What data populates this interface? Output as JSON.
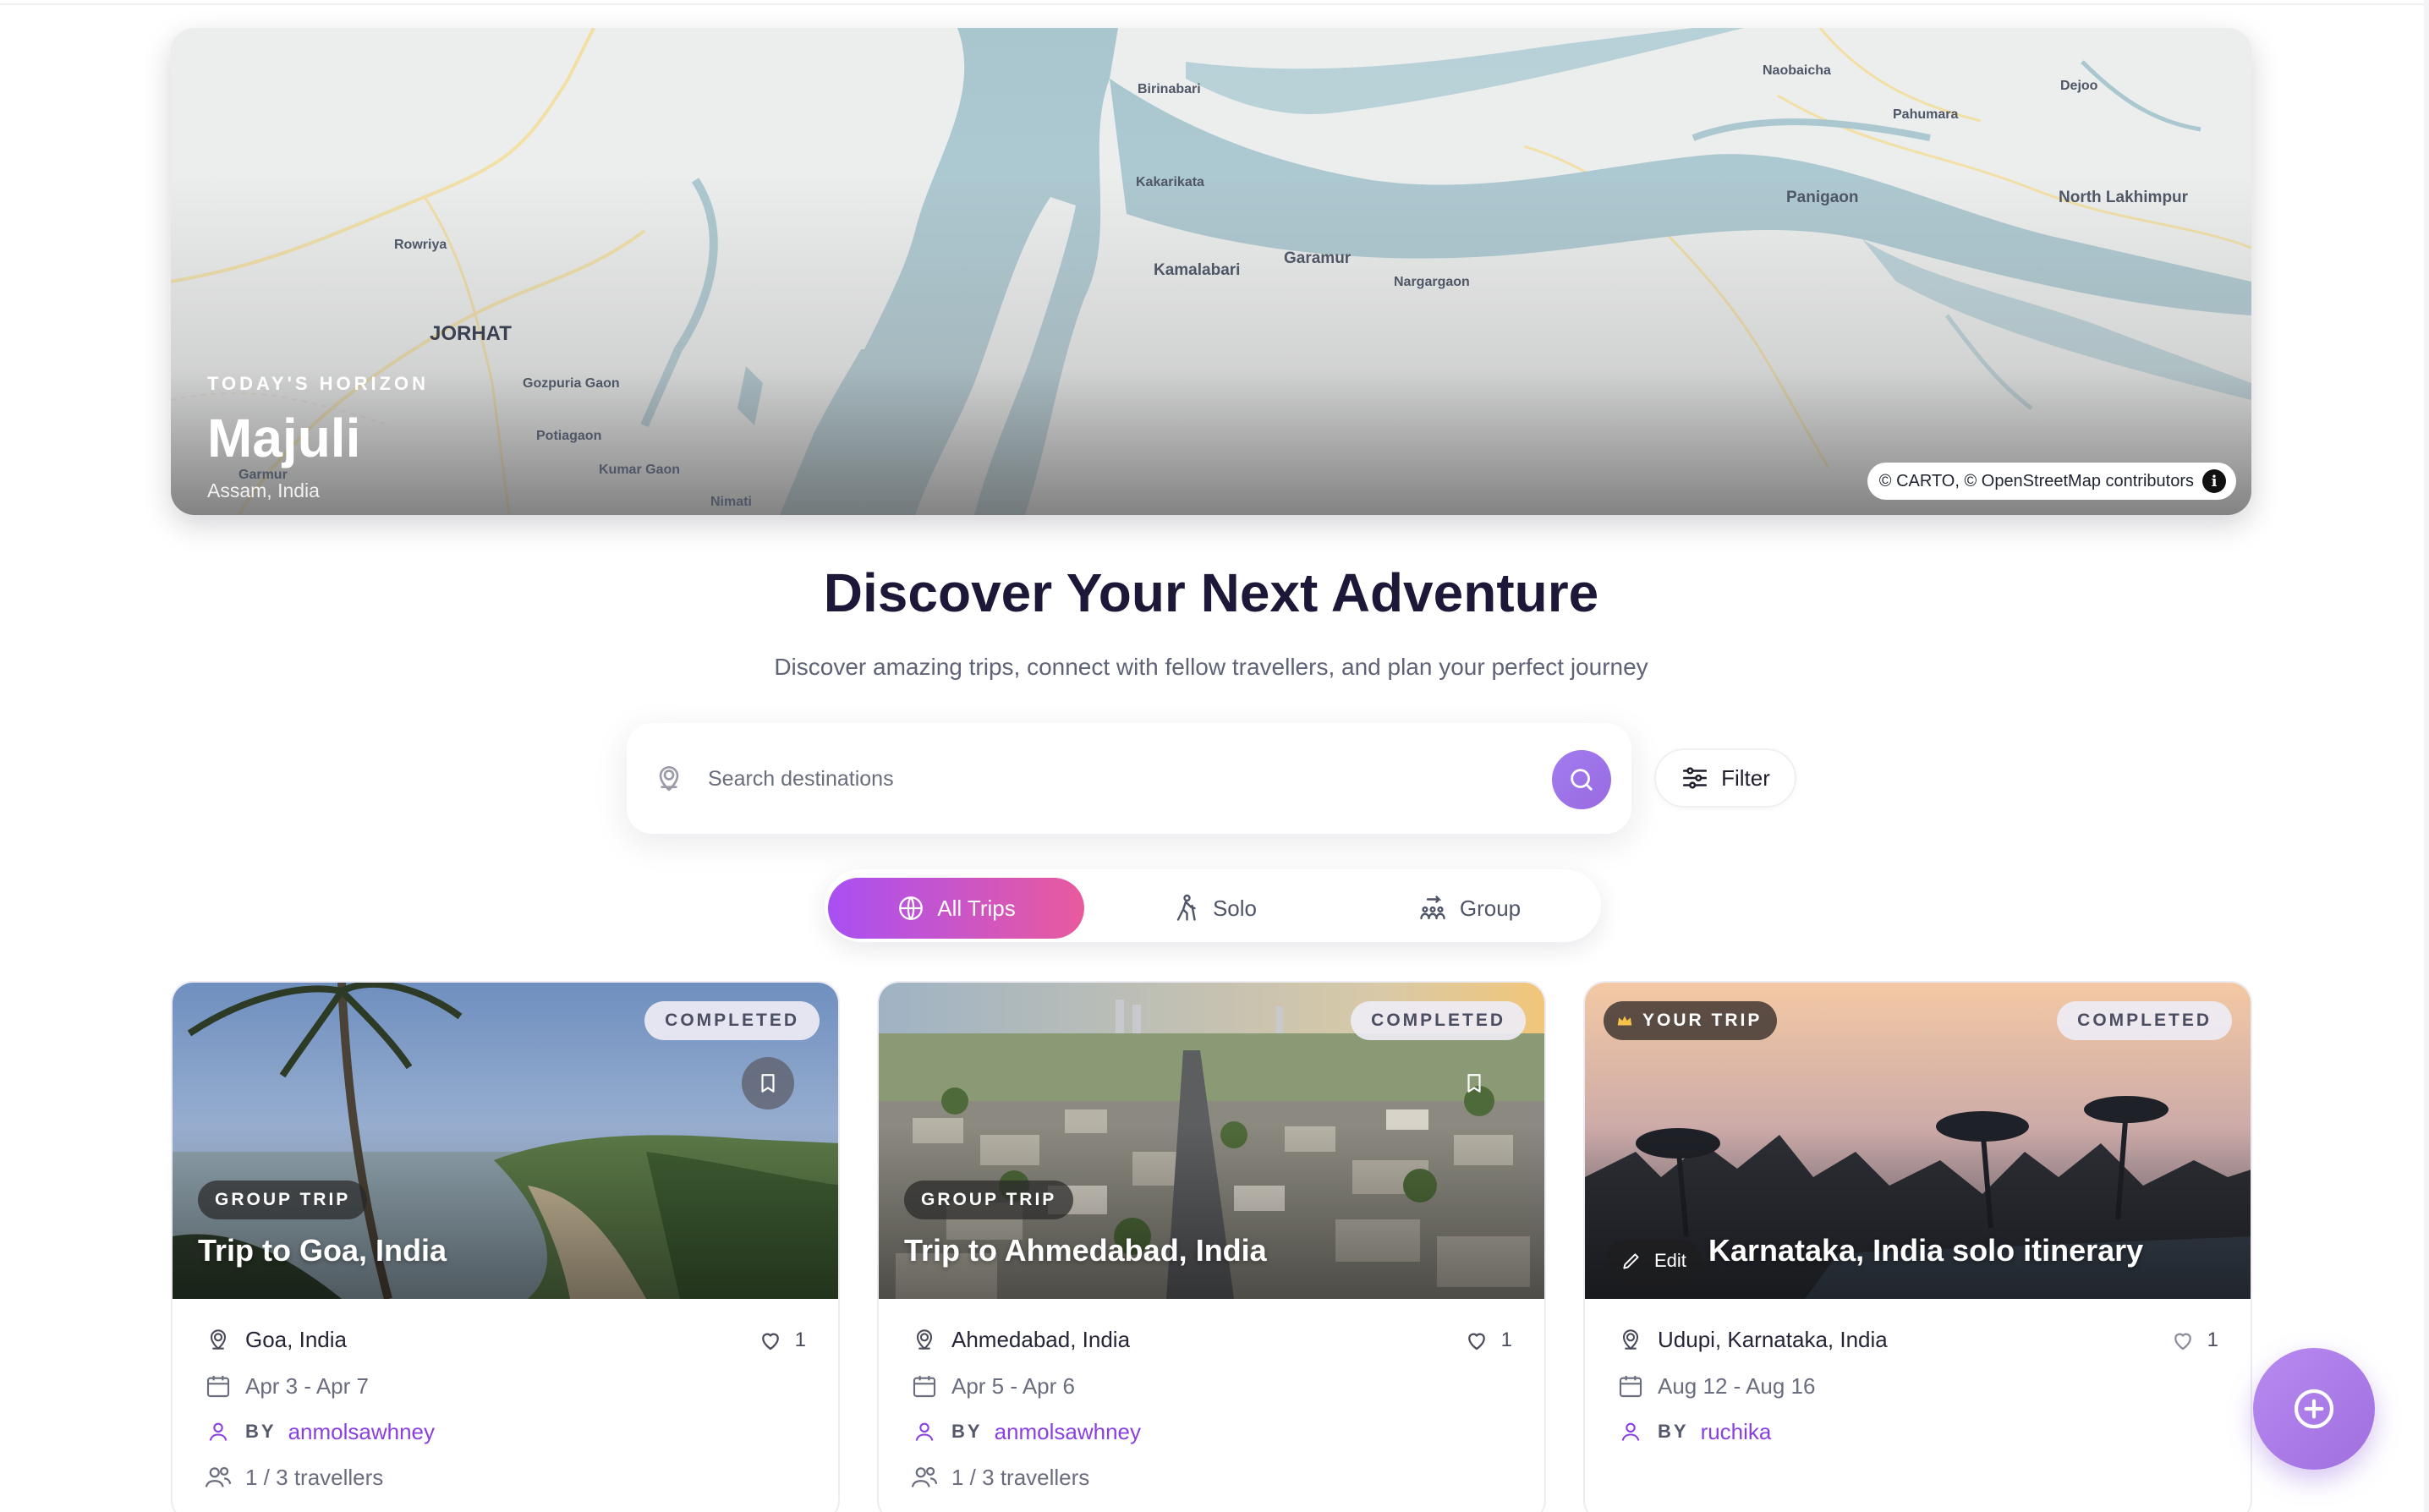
{
  "hero": {
    "kicker": "TODAY'S HORIZON",
    "title": "Majuli",
    "subtitle": "Assam, India",
    "attribution": "© CARTO, © OpenStreetMap contributors",
    "map_labels": [
      "Birinabari",
      "Naobaicha",
      "Dejoo",
      "Pahumara",
      "Kakarikata",
      "Panigaon",
      "North Lakhimpur",
      "Rowriya",
      "Kamalabari",
      "Garamur",
      "Nargargaon",
      "JORHAT",
      "Gozpuria Gaon",
      "Potiagaon",
      "Kumar Gaon",
      "Garmur",
      "Nimati"
    ]
  },
  "page": {
    "title": "Discover Your Next Adventure",
    "subtitle": "Discover amazing trips, connect with fellow travellers, and plan your perfect journey"
  },
  "search": {
    "placeholder": "Search destinations",
    "filter_label": "Filter"
  },
  "tabs": [
    {
      "label": "All Trips",
      "active": true
    },
    {
      "label": "Solo",
      "active": false
    },
    {
      "label": "Group",
      "active": false
    }
  ],
  "cards": [
    {
      "status": "COMPLETED",
      "type": "GROUP TRIP",
      "title": "Trip to Goa, India",
      "location": "Goa, India",
      "likes": "1",
      "dates": "Apr 3 - Apr 7",
      "by_label": "BY",
      "user": "anmolsawhney",
      "travellers": "1 / 3 travellers"
    },
    {
      "status": "COMPLETED",
      "type": "GROUP TRIP",
      "title": "Trip to Ahmedabad, India",
      "location": "Ahmedabad, India",
      "likes": "1",
      "dates": "Apr 5 - Apr 6",
      "by_label": "BY",
      "user": "anmolsawhney",
      "travellers": "1 / 3 travellers"
    },
    {
      "status": "COMPLETED",
      "your_trip": "YOUR TRIP",
      "title": "Karnataka, India solo itinerary",
      "edit_label": "Edit",
      "location": "Udupi, Karnataka, India",
      "likes": "1",
      "dates": "Aug 12 - Aug 16",
      "by_label": "BY",
      "user": "ruchika"
    }
  ],
  "colors": {
    "accent_purple": "#8a3fe0",
    "tab_gradient_start": "#a950f3",
    "tab_gradient_end": "#e95a9d",
    "fab": "#a06fe0"
  }
}
